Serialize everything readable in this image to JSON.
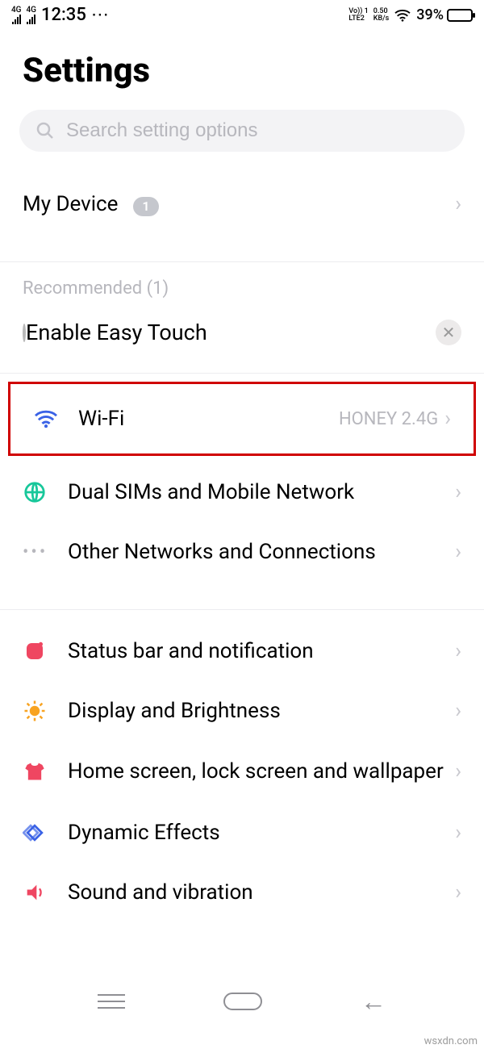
{
  "status_bar": {
    "signal1_label": "4G",
    "signal2_label": "4G",
    "time": "12:35",
    "more_icon": "⋯",
    "lte_top": "Vo)) 1",
    "lte_bottom": "LTE2",
    "speed_top": "0.50",
    "speed_bottom": "KB/s",
    "battery_percent": "39%"
  },
  "title": "Settings",
  "search": {
    "placeholder": "Search setting options"
  },
  "my_device": {
    "label": "My Device",
    "badge": "1"
  },
  "recommended": {
    "header": "Recommended (1)",
    "item_label": "Enable Easy Touch"
  },
  "rows": {
    "wifi": {
      "label": "Wi-Fi",
      "value": "HONEY 2.4G"
    },
    "dual_sim": {
      "label": "Dual SIMs and Mobile Network"
    },
    "other_net": {
      "label": "Other Networks and Connections"
    },
    "status_bar": {
      "label": "Status bar and notification"
    },
    "display": {
      "label": "Display and Brightness"
    },
    "home": {
      "label": "Home screen, lock screen and wallpaper"
    },
    "dynamic": {
      "label": "Dynamic Effects"
    },
    "sound": {
      "label": "Sound and vibration"
    }
  },
  "watermark": "wsxdn.com"
}
